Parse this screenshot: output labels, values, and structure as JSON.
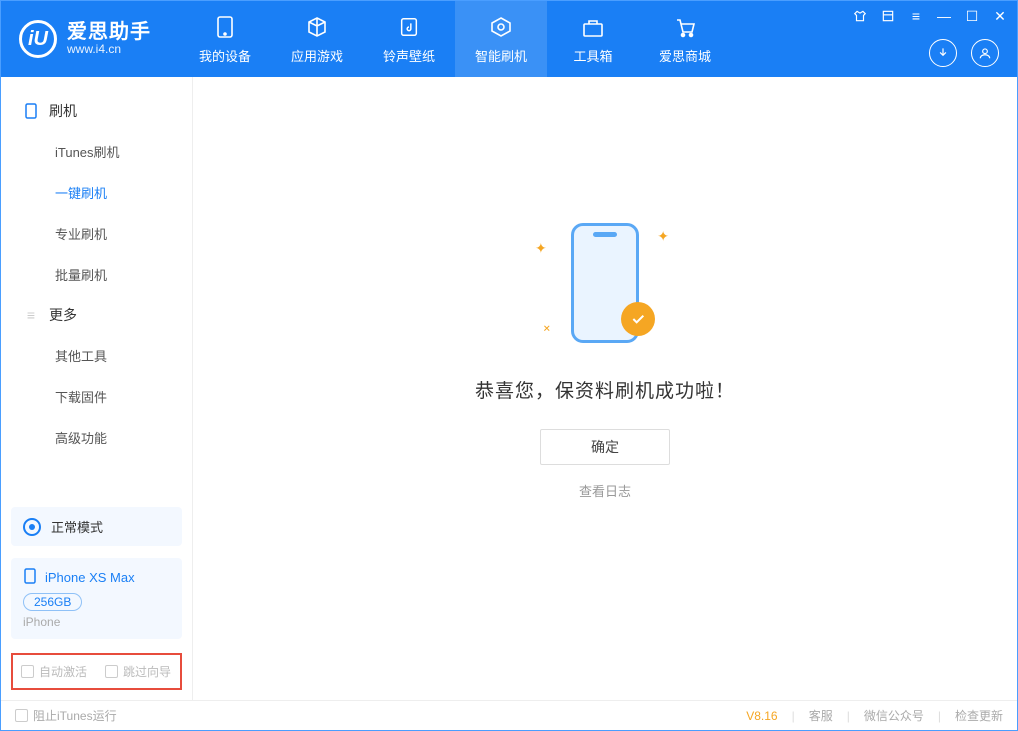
{
  "app": {
    "name": "爱思助手",
    "url": "www.i4.cn"
  },
  "window_controls": {
    "shirt": "⬡",
    "menu": "☰",
    "menu_label": "menu",
    "min": "—",
    "max": "☐",
    "close": "✕"
  },
  "tabs": [
    {
      "label": "我的设备",
      "icon": "device"
    },
    {
      "label": "应用游戏",
      "icon": "cube"
    },
    {
      "label": "铃声壁纸",
      "icon": "music"
    },
    {
      "label": "智能刷机",
      "icon": "refresh",
      "active": true
    },
    {
      "label": "工具箱",
      "icon": "toolbox"
    },
    {
      "label": "爱思商城",
      "icon": "cart"
    }
  ],
  "sidebar": {
    "section1_title": "刷机",
    "items1": [
      "iTunes刷机",
      "一键刷机",
      "专业刷机",
      "批量刷机"
    ],
    "active1_index": 1,
    "section2_title": "更多",
    "items2": [
      "其他工具",
      "下载固件",
      "高级功能"
    ]
  },
  "mode": {
    "label": "正常模式"
  },
  "device": {
    "name": "iPhone XS Max",
    "capacity": "256GB",
    "type": "iPhone"
  },
  "checkboxes": {
    "auto_activate": "自动激活",
    "skip_wizard": "跳过向导"
  },
  "main": {
    "success": "恭喜您，保资料刷机成功啦！",
    "ok": "确定",
    "view_log": "查看日志"
  },
  "footer": {
    "stop_itunes": "阻止iTunes运行",
    "version": "V8.16",
    "support": "客服",
    "wechat": "微信公众号",
    "update": "检查更新"
  }
}
